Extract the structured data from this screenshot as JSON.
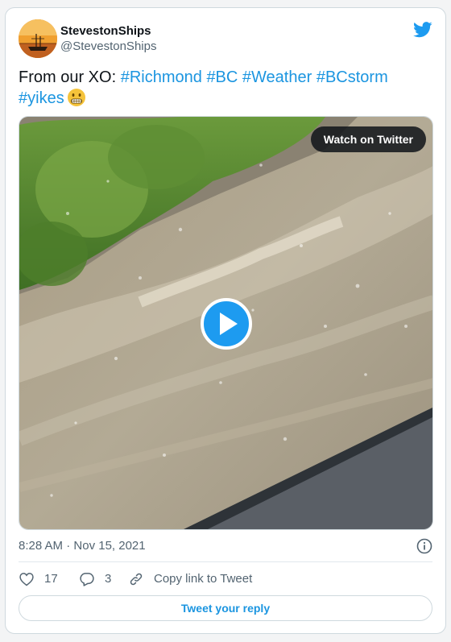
{
  "author": {
    "display_name": "StevestonShips",
    "handle": "@StevestonShips"
  },
  "tweet": {
    "text_prefix": "From our XO: ",
    "hashtags": [
      "#Richmond",
      "#BC",
      "#Weather",
      "#BCstorm",
      "#yikes"
    ],
    "emoji": "grimacing-face"
  },
  "media": {
    "watch_label": "Watch on Twitter"
  },
  "meta": {
    "time": "8:28 AM",
    "separator": " · ",
    "date": "Nov 15, 2021"
  },
  "actions": {
    "like_count": "17",
    "reply_count": "3",
    "copy_link_label": "Copy link to Tweet"
  },
  "reply_button_label": "Tweet your reply",
  "colors": {
    "link": "#1b95e0",
    "play_button": "#1d9bf0",
    "muted_text": "#536471"
  }
}
